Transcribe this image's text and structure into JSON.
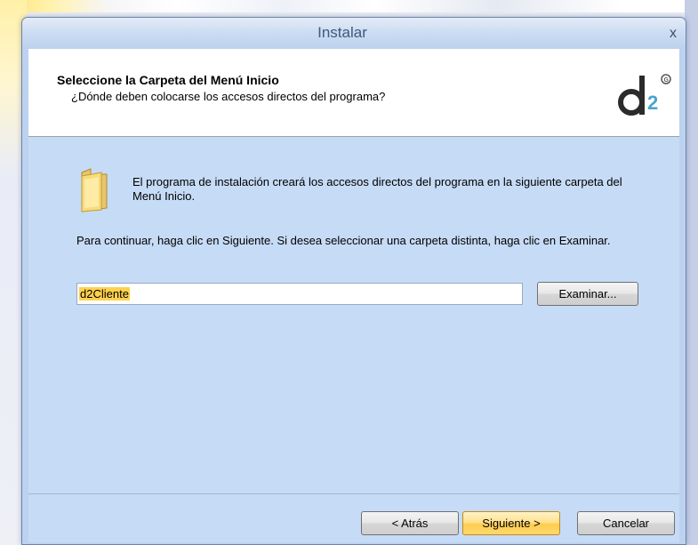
{
  "window": {
    "title": "Instalar",
    "close_label": "x"
  },
  "header": {
    "title": "Seleccione la Carpeta del Menú Inicio",
    "subtitle": "¿Dónde deben colocarse los accesos directos del programa?"
  },
  "body": {
    "intro": "El programa de instalación creará los accesos directos del programa en la siguiente carpeta del Menú Inicio.",
    "continue": "Para continuar, haga clic en Siguiente. Si desea seleccionar una carpeta distinta, haga clic en Examinar.",
    "folder_value": "d2Cliente",
    "browse_label": "Examinar..."
  },
  "buttons": {
    "back": "< Atrás",
    "next": "Siguiente >",
    "cancel": "Cancelar"
  },
  "icons": {
    "folder": "folder-icon",
    "logo": "d2-logo",
    "close": "close-icon"
  },
  "colors": {
    "window_bg": "#c6dbf5",
    "selection": "#ffd24d",
    "primary_button": "#ffcd4f"
  }
}
